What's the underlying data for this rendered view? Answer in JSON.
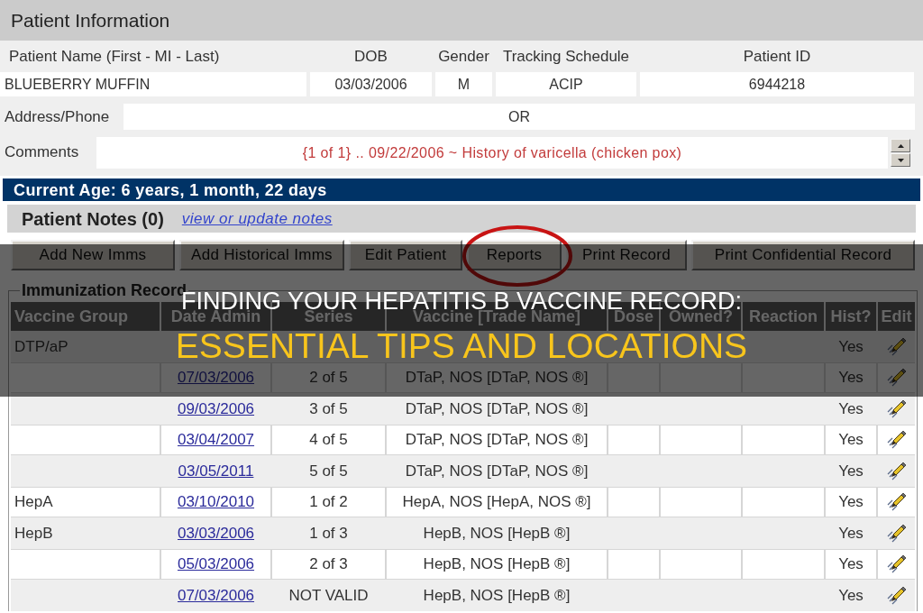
{
  "patient_information": {
    "title": "Patient Information",
    "fields": [
      {
        "label": "Patient Name (First - MI - Last)",
        "value": "BLUEBERRY MUFFIN"
      },
      {
        "label": "DOB",
        "value": "03/03/2006"
      },
      {
        "label": "Gender",
        "value": "M"
      },
      {
        "label": "Tracking Schedule",
        "value": "ACIP"
      },
      {
        "label": "Patient ID",
        "value": "6944218"
      }
    ],
    "address_phone": {
      "label": "Address/Phone",
      "value": "OR"
    },
    "comments": {
      "label": "Comments",
      "value": "{1 of 1} .. 09/22/2006 ~ History of varicella (chicken pox)"
    }
  },
  "current_age": "Current Age: 6 years, 1 month, 22 days",
  "patient_notes": {
    "title": "Patient Notes (0)",
    "link": "view or update notes"
  },
  "buttons": [
    {
      "label": "Add New Imms",
      "circled": false
    },
    {
      "label": "Add Historical Imms",
      "circled": false
    },
    {
      "label": "Edit Patient",
      "circled": false
    },
    {
      "label": "Reports",
      "circled": true
    },
    {
      "label": "Print Record",
      "circled": false
    },
    {
      "label": "Print Confidential Record",
      "circled": false
    }
  ],
  "immunization_record": {
    "title": "Immunization Record",
    "columns": [
      "Vaccine Group",
      "Date Admin",
      "Series",
      "Vaccine [Trade Name]",
      "Dose",
      "Owned?",
      "Reaction",
      "Hist?",
      "Edit"
    ],
    "rows": [
      {
        "vaccine_group": "DTP/aP",
        "hist": "Yes"
      },
      {
        "date_admin": "07/03/2006",
        "series": "2 of 5",
        "vaccine": "DTaP, NOS [DTaP, NOS ®]",
        "hist": "Yes"
      },
      {
        "date_admin": "09/03/2006",
        "series": "3 of 5",
        "vaccine": "DTaP, NOS [DTaP, NOS ®]",
        "hist": "Yes"
      },
      {
        "date_admin": "03/04/2007",
        "series": "4 of 5",
        "vaccine": "DTaP, NOS [DTaP, NOS ®]",
        "hist": "Yes"
      },
      {
        "date_admin": "03/05/2011",
        "series": "5 of 5",
        "vaccine": "DTaP, NOS [DTaP, NOS ®]",
        "hist": "Yes"
      },
      {
        "vaccine_group": "HepA",
        "date_admin": "03/10/2010",
        "series": "1 of 2",
        "vaccine": "HepA, NOS [HepA, NOS ®]",
        "hist": "Yes"
      },
      {
        "vaccine_group": "HepB",
        "date_admin": "03/03/2006",
        "series": "1 of 3",
        "vaccine": "HepB, NOS [HepB ®]",
        "hist": "Yes"
      },
      {
        "date_admin": "05/03/2006",
        "series": "2 of 3",
        "vaccine": "HepB, NOS [HepB ®]",
        "hist": "Yes"
      },
      {
        "date_admin": "07/03/2006",
        "series": "NOT VALID",
        "vaccine": "HepB, NOS [HepB ®]",
        "hist": "Yes"
      }
    ]
  },
  "headline": {
    "title": "FINDING YOUR HEPATITIS B VACCINE RECORD:",
    "subtitle": "ESSENTIAL TIPS AND LOCATIONS"
  }
}
